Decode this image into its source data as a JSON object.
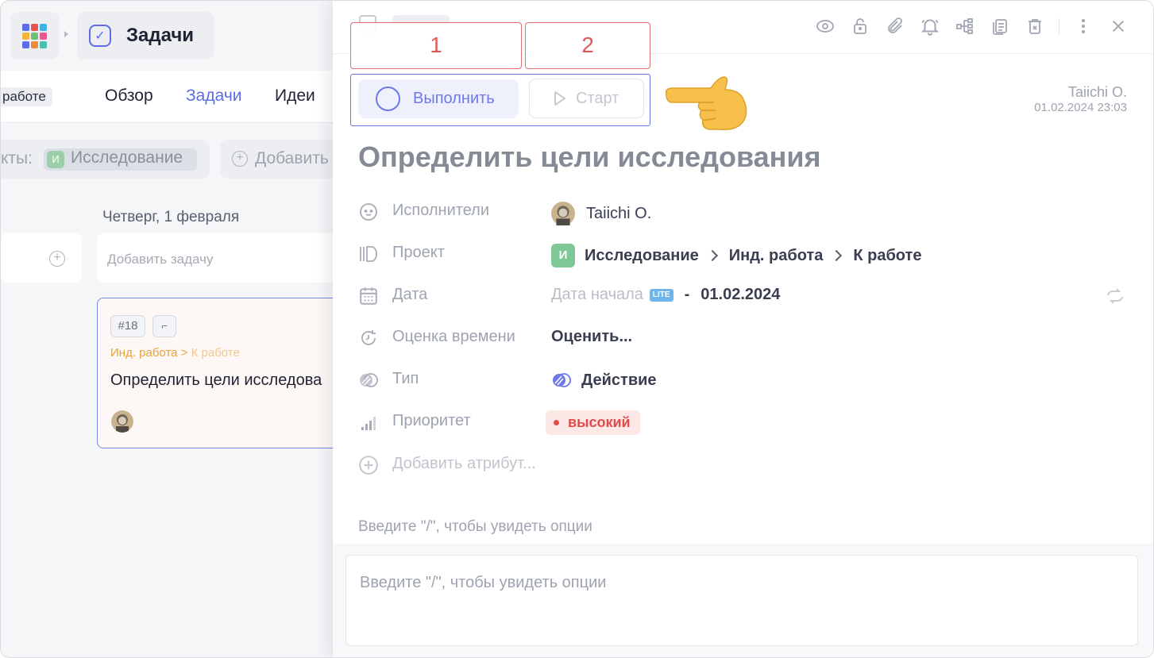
{
  "app": {
    "title": "Задачи",
    "grid_colors": [
      "#5d6ce8",
      "#e8554e",
      "#3fb0e8",
      "#f4b43a",
      "#6bc17a",
      "#e85a8f",
      "#5d6ce8",
      "#f08a3c",
      "#4ac0b0"
    ]
  },
  "left": {
    "status_chip": "работе",
    "tabs": [
      "Обзор",
      "Задачи",
      "Идеи"
    ],
    "active_tab": "Задачи",
    "filter_label": "кты:",
    "filter_tag_letter": "И",
    "filter_tag": "Исследование",
    "add_filter": "Добавить",
    "day_title": "Четверг, 1 февраля",
    "add_task_placeholder": "Добавить задачу",
    "card": {
      "number": "#18",
      "path_project": "Инд. работа",
      "path_sep": ">",
      "path_status": "К работе",
      "title": "Определить цели исследова"
    }
  },
  "annotations": {
    "label_1": "1",
    "label_2": "2"
  },
  "panel": {
    "complete_button": "Выполнить",
    "start_button": "Старт",
    "author": "Taiichi O.",
    "created": "01.02.2024 23:03",
    "title": "Определить цели исследования",
    "attributes": {
      "assignees_label": "Исполнители",
      "assignee": "Taiichi O.",
      "project_label": "Проект",
      "project_letter": "И",
      "project": "Исследование",
      "project_group": "Инд. работа",
      "project_status": "К работе",
      "date_label": "Дата",
      "start_date_placeholder": "Дата начала",
      "lite_badge": "LITE",
      "date_sep": "-",
      "due_date": "01.02.2024",
      "estimate_label": "Оценка времени",
      "estimate_value": "Оценить...",
      "type_label": "Тип",
      "type_value": "Действие",
      "priority_label": "Приоритет",
      "priority_value": "высокий",
      "add_attribute": "Добавить атрибут..."
    },
    "description_placeholder": "Введите \"/\", чтобы увидеть опции",
    "comment_placeholder": "Введите \"/\", чтобы увидеть опции"
  },
  "colors": {
    "accent": "#5d6ce8",
    "priority_high": "#e24a4a",
    "annotation_red": "#dc5b5b"
  },
  "icons": [
    "eye-icon",
    "lock-icon",
    "paperclip-icon",
    "bell-icon",
    "hierarchy-icon",
    "copy-icon",
    "trash-icon",
    "more-vertical-icon",
    "close-icon"
  ]
}
